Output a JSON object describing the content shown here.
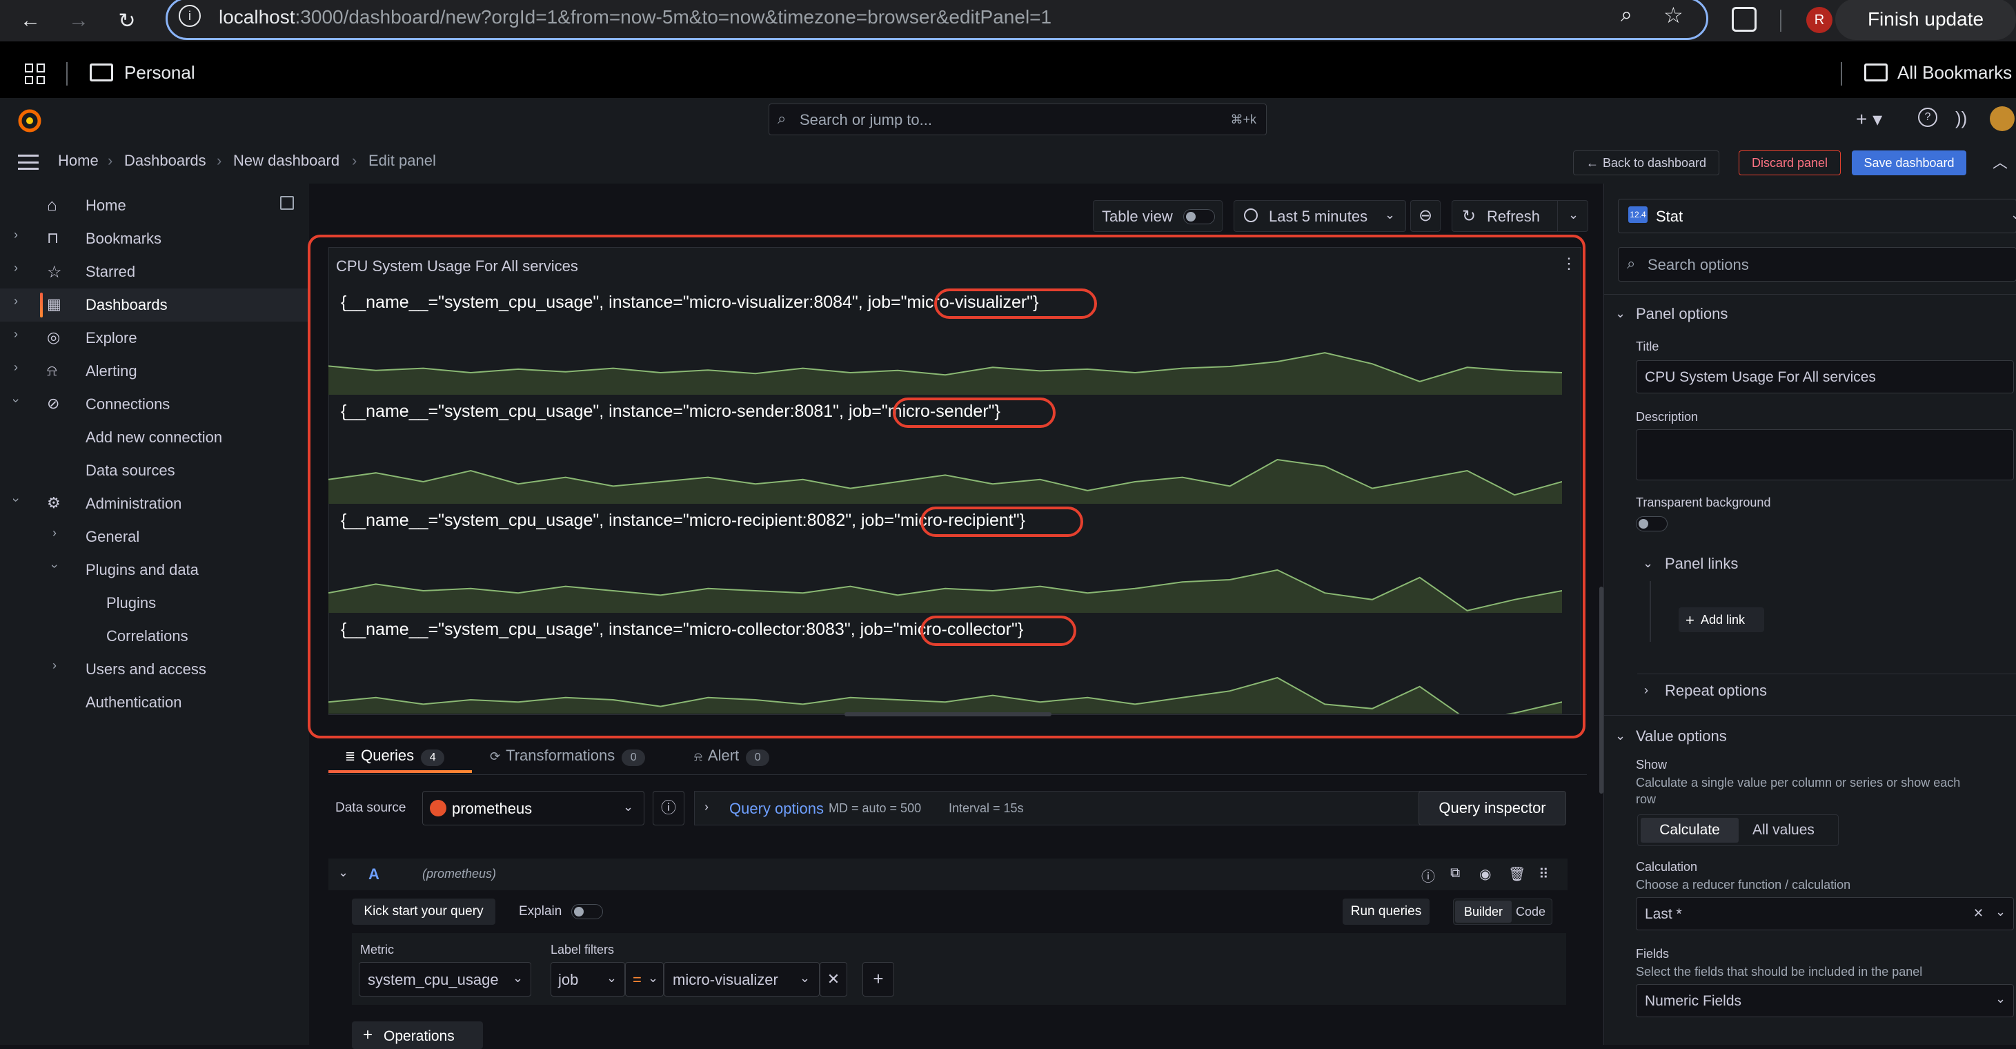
{
  "browser": {
    "url_host": "localhost",
    "url_rest": ":3000/dashboard/new?orgId=1&from=now-5m&to=now&timezone=browser&editPanel=1",
    "profile_initial": "R",
    "finish_update": "Finish update",
    "bookmarks": {
      "personal": "Personal",
      "all": "All Bookmarks"
    }
  },
  "topbar": {
    "search_placeholder": "Search or jump to...",
    "search_shortcut": "⌘+k"
  },
  "breadcrumb": [
    "Home",
    "Dashboards",
    "New dashboard",
    "Edit panel"
  ],
  "actions": {
    "back": "Back to dashboard",
    "discard": "Discard panel",
    "save": "Save dashboard"
  },
  "sidebar": {
    "items": [
      {
        "label": "Home",
        "icon": "home-icon"
      },
      {
        "label": "Bookmarks",
        "icon": "bookmark-icon"
      },
      {
        "label": "Starred",
        "icon": "star-icon"
      },
      {
        "label": "Dashboards",
        "icon": "apps-icon"
      },
      {
        "label": "Explore",
        "icon": "compass-icon"
      },
      {
        "label": "Alerting",
        "icon": "bell-icon"
      },
      {
        "label": "Connections",
        "icon": "plug-icon"
      },
      {
        "label": "Add new connection"
      },
      {
        "label": "Data sources"
      },
      {
        "label": "Administration",
        "icon": "cog-icon"
      },
      {
        "label": "General"
      },
      {
        "label": "Plugins and data"
      },
      {
        "label": "Plugins"
      },
      {
        "label": "Correlations"
      },
      {
        "label": "Users and access"
      },
      {
        "label": "Authentication"
      }
    ]
  },
  "toolbar": {
    "table_view": "Table view",
    "time_range": "Last 5 minutes",
    "refresh": "Refresh"
  },
  "panel": {
    "title": "CPU System Usage For All services",
    "series": [
      {
        "prefix": "{__name__=\"system_cpu_usage\", instance=\"micro-visualizer:8084\", job=",
        "job": "\"micro-visualizer\"",
        "suffix": "}"
      },
      {
        "prefix": "{__name__=\"system_cpu_usage\", instance=\"micro-sender:8081\", job=",
        "job": "\"micro-sender\"",
        "suffix": "}"
      },
      {
        "prefix": "{__name__=\"system_cpu_usage\", instance=\"micro-recipient:8082\", job=",
        "job": "\"micro-recipient\"",
        "suffix": "}"
      },
      {
        "prefix": "{__name__=\"system_cpu_usage\", instance=\"micro-collector:8083\", job=",
        "job": "\"micro-collector\"",
        "suffix": "}"
      }
    ]
  },
  "query_tabs": {
    "queries": "Queries",
    "queries_count": "4",
    "transformations": "Transformations",
    "transformations_count": "0",
    "alert": "Alert",
    "alert_count": "0"
  },
  "datasource": {
    "label": "Data source",
    "value": "prometheus",
    "query_options": "Query options",
    "md": "MD = auto = 500",
    "interval": "Interval = 15s",
    "inspector": "Query inspector"
  },
  "query_a": {
    "ref": "A",
    "ds": "(prometheus)",
    "kick_start": "Kick start your query",
    "explain": "Explain",
    "run": "Run queries",
    "builder": "Builder",
    "code": "Code",
    "metric_label": "Metric",
    "metric_value": "system_cpu_usage",
    "filters_label": "Label filters",
    "filter_key": "job",
    "filter_op": "=",
    "filter_value": "micro-visualizer",
    "operations": "Operations"
  },
  "options": {
    "viz": "Stat",
    "viz_badge": "12.4",
    "search_placeholder": "Search options",
    "panel_options": "Panel options",
    "title_label": "Title",
    "title_value": "CPU System Usage For All services",
    "description_label": "Description",
    "transparent_label": "Transparent background",
    "panel_links": "Panel links",
    "add_link": "Add link",
    "repeat_options": "Repeat options",
    "value_options": "Value options",
    "show_label": "Show",
    "show_desc_1": "Calculate a single value per column or series or show each",
    "show_desc_2": "row",
    "calculate": "Calculate",
    "all_values": "All values",
    "calc_label": "Calculation",
    "calc_desc": "Choose a reducer function / calculation",
    "calc_value": "Last *",
    "fields_label": "Fields",
    "fields_desc": "Select the fields that should be included in the panel",
    "fields_value": "Numeric Fields"
  },
  "colors": {
    "accent": "#f55f3e",
    "primary": "#3d71d9",
    "highlight": "#e5402e",
    "spark_fill": "#2e3b28",
    "spark_line": "#8ab873"
  },
  "sparklines": [
    [
      0.65,
      0.55,
      0.6,
      0.5,
      0.58,
      0.52,
      0.6,
      0.5,
      0.56,
      0.48,
      0.6,
      0.5,
      0.55,
      0.45,
      0.62,
      0.54,
      0.58,
      0.5,
      0.6,
      0.64,
      0.75,
      0.95,
      0.7,
      0.3,
      0.62,
      0.54,
      0.5
    ],
    [
      0.55,
      0.7,
      0.5,
      0.75,
      0.45,
      0.6,
      0.4,
      0.5,
      0.6,
      0.45,
      0.55,
      0.35,
      0.5,
      0.65,
      0.45,
      0.55,
      0.3,
      0.5,
      0.6,
      0.4,
      1.0,
      0.85,
      0.35,
      0.55,
      0.75,
      0.2,
      0.5
    ],
    [
      0.45,
      0.65,
      0.5,
      0.55,
      0.45,
      0.6,
      0.5,
      0.4,
      0.55,
      0.5,
      0.45,
      0.6,
      0.4,
      0.55,
      0.5,
      0.6,
      0.45,
      0.55,
      0.7,
      0.75,
      0.97,
      0.45,
      0.3,
      0.8,
      0.05,
      0.3,
      0.5
    ],
    [
      0.45,
      0.55,
      0.4,
      0.5,
      0.45,
      0.55,
      0.5,
      0.35,
      0.55,
      0.5,
      0.4,
      0.55,
      0.5,
      0.45,
      0.6,
      0.45,
      0.55,
      0.4,
      0.55,
      0.7,
      1.0,
      0.4,
      0.3,
      0.8,
      0.05,
      0.2,
      0.45
    ]
  ]
}
